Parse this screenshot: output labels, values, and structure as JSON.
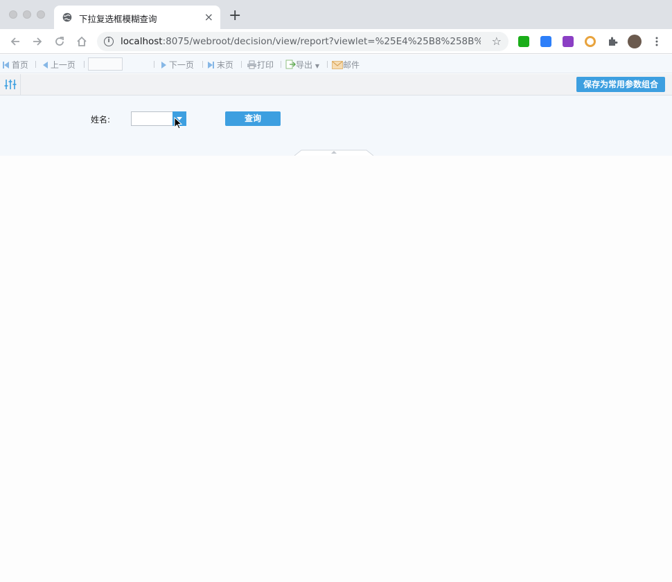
{
  "browser": {
    "tab_title": "下拉复选框模糊查询",
    "tab_close": "×",
    "new_tab": "+",
    "url_host": "localhost",
    "url_rest": ":8075/webroot/decision/view/report?viewlet=%25E4%25B8%258B%2...",
    "star": "☆"
  },
  "toolbar": {
    "first_page": "首页",
    "prev_page": "上一页",
    "next_page": "下一页",
    "last_page": "末页",
    "print": "打印",
    "export": "导出",
    "mail": "邮件",
    "page_value": ""
  },
  "param_panel": {
    "save_label": "保存为常用参数组合",
    "name_label": "姓名:",
    "name_value": "",
    "query_label": "查询"
  },
  "colors": {
    "accent": "#3d9fe0",
    "toolbar_bg": "#f4f8fc",
    "tab_strip": "#dee1e6"
  }
}
